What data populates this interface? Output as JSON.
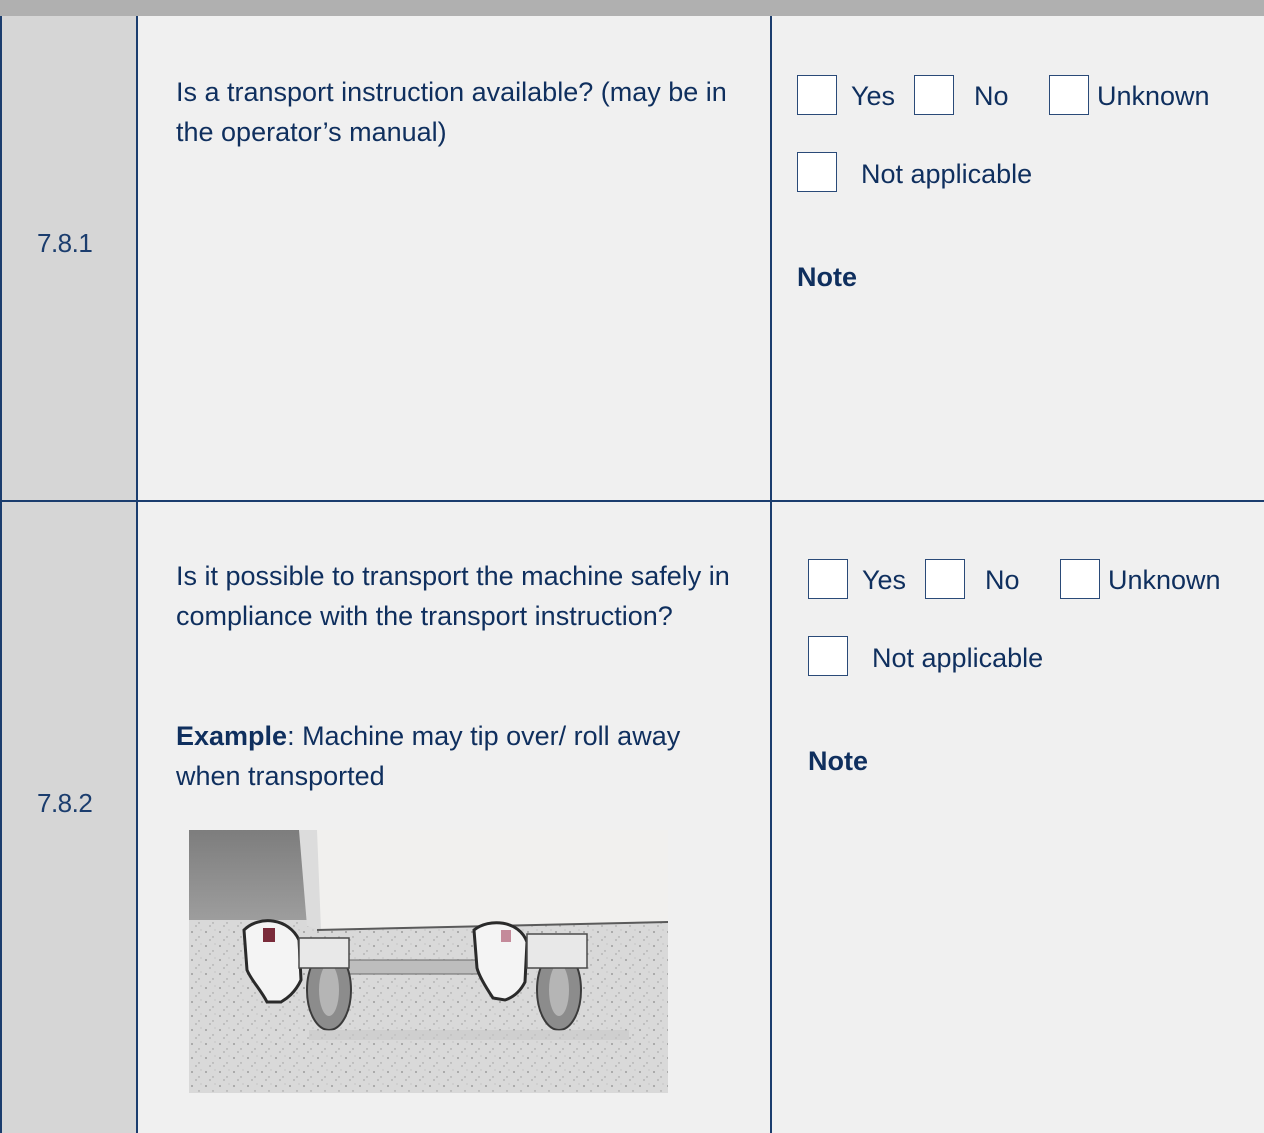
{
  "rows": [
    {
      "number": "7.8.1",
      "question": "Is a transport instruction available? (may be in the operator’s manual)",
      "options": {
        "yes": "Yes",
        "no": "No",
        "unknown": "Unknown",
        "not_applicable": "Not applicable"
      },
      "note_label": "Note"
    },
    {
      "number": "7.8.2",
      "question": "Is it possible to transport the machine safely in compliance with the transport instruction?",
      "example_label": "Example",
      "example_text": ": Machine may tip over/ roll away when transported",
      "options": {
        "yes": "Yes",
        "no": "No",
        "unknown": "Unknown",
        "not_applicable": "Not applicable"
      },
      "note_label": "Note"
    }
  ],
  "colors": {
    "border": "#1b3d6e",
    "text": "#0f2f5e",
    "number_column": "#d6d6d6",
    "cell_background": "#f0f0f0",
    "header_bar": "#b0b0b0"
  }
}
